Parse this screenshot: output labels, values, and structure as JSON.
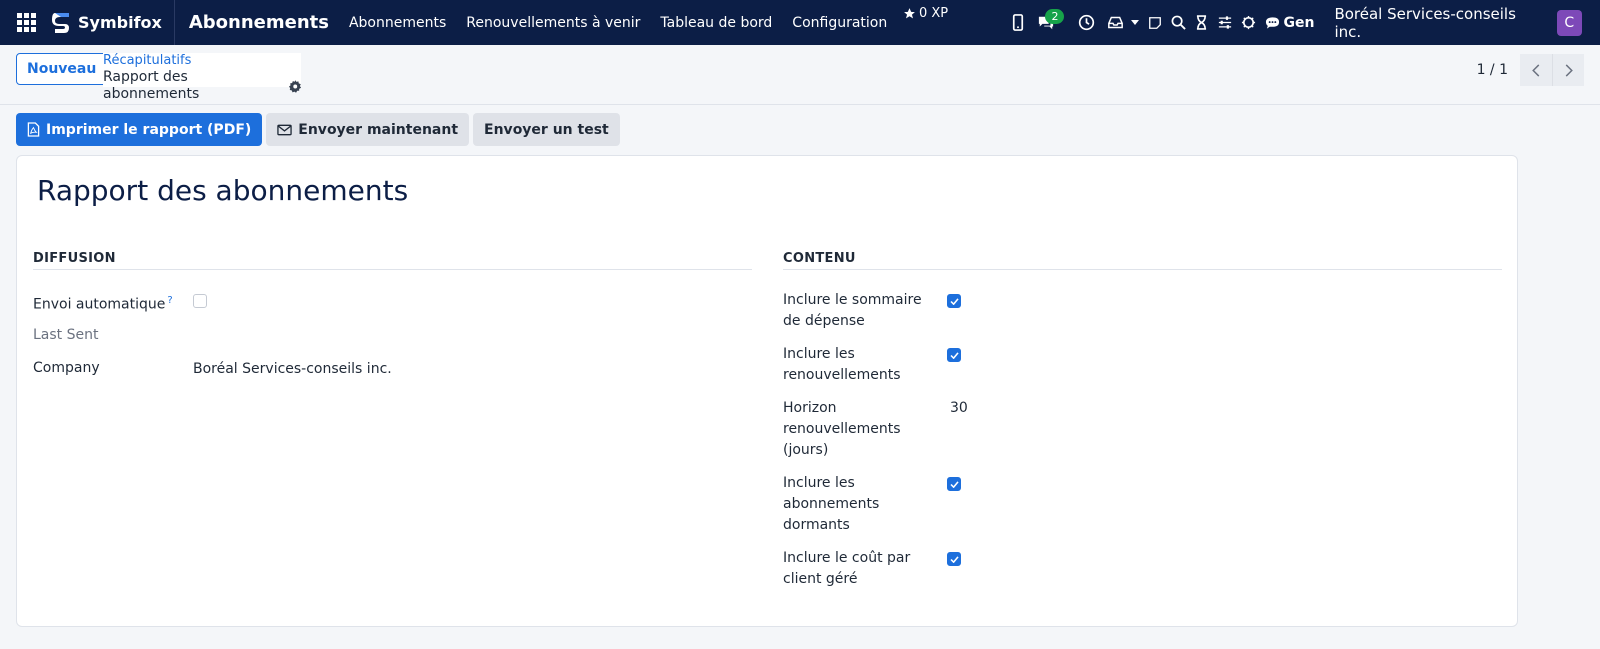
{
  "navbar": {
    "brand": "Symbifox",
    "app_title": "Abonnements",
    "menu": [
      "Abonnements",
      "Renouvellements à venir",
      "Tableau de bord",
      "Configuration"
    ],
    "xp": "0 XP",
    "messages_badge": "2",
    "gen_label": "Gen",
    "company": "Boréal Services-conseils inc.",
    "avatar_initial": "C",
    "avatar_color": "#7d49b8",
    "bg_color": "#0c1e46"
  },
  "control_panel": {
    "new_button": "Nouveau",
    "breadcrumb_parent": "Récapitulatifs",
    "breadcrumb_current": "Rapport des abonnements",
    "pager": "1 / 1"
  },
  "actions": {
    "print": "Imprimer le rapport (PDF)",
    "send_now": "Envoyer maintenant",
    "send_test": "Envoyer un test"
  },
  "form": {
    "title": "Rapport des abonnements",
    "diffusion": {
      "heading": "DIFFUSION",
      "auto_send_label": "Envoi automatique",
      "auto_send_help": "?",
      "auto_send_checked": false,
      "last_sent_label": "Last Sent",
      "company_label": "Company",
      "company_value": "Boréal Services-conseils inc."
    },
    "contenu": {
      "heading": "CONTENU",
      "expense_summary_line1": "Inclure le sommaire",
      "expense_summary_line2": "de dépense",
      "renewals_line1": "Inclure les",
      "renewals_line2": "renouvellements",
      "horizon_line1": "Horizon",
      "horizon_line2": "renouvellements",
      "horizon_line3": "(jours)",
      "horizon_value": "30",
      "dormant_line1": "Inclure les",
      "dormant_line2": "abonnements",
      "dormant_line3": "dormants",
      "cost_line1": "Inclure le coût par",
      "cost_line2": "client géré"
    }
  },
  "colors": {
    "accent": "#1d6fdc",
    "title": "#0c1e46"
  }
}
